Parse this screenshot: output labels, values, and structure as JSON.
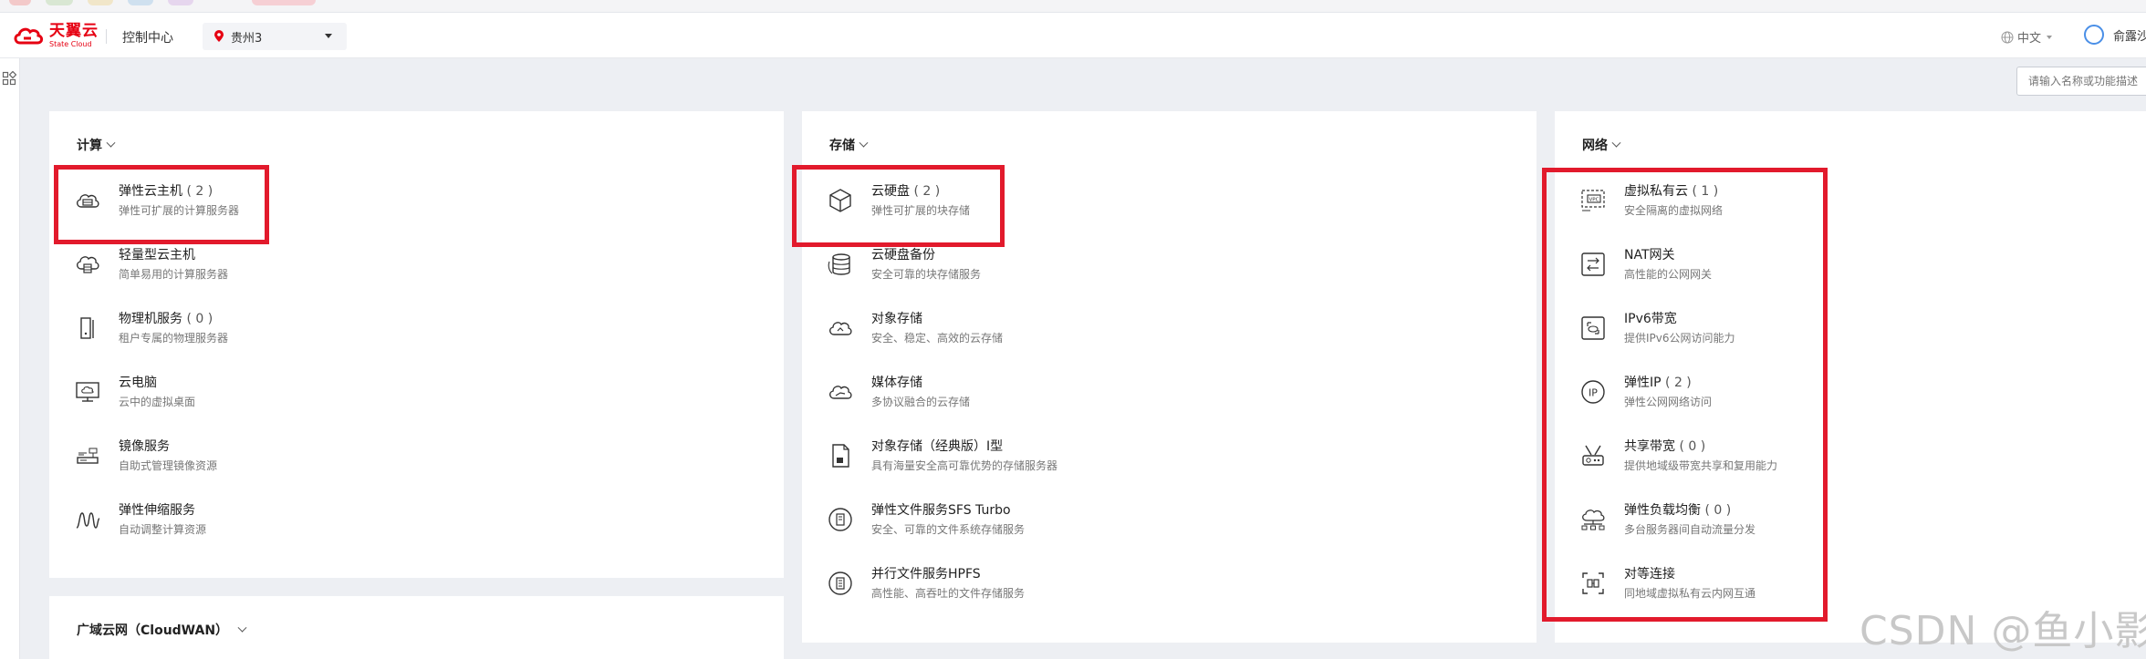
{
  "header": {
    "logo_cn": "天翼云",
    "logo_en": "State Cloud",
    "console_label": "控制中心",
    "region": "贵州3",
    "language": "中文",
    "user": "俞露沙"
  },
  "search": {
    "placeholder": "请输入名称或功能描述"
  },
  "compute": {
    "title": "计算",
    "items": [
      {
        "name": "弹性云主机",
        "count": "( 2 )",
        "desc": "弹性可扩展的计算服务器",
        "icon": "cloud-server-icon"
      },
      {
        "name": "轻量型云主机",
        "count": "",
        "desc": "简单易用的计算服务器",
        "icon": "lightweight-server-icon"
      },
      {
        "name": "物理机服务",
        "count": "( 0 )",
        "desc": "租户专属的物理服务器",
        "icon": "physical-server-icon"
      },
      {
        "name": "云电脑",
        "count": "",
        "desc": "云中的虚拟桌面",
        "icon": "cloud-desktop-icon"
      },
      {
        "name": "镜像服务",
        "count": "",
        "desc": "自助式管理镜像资源",
        "icon": "image-service-icon"
      },
      {
        "name": "弹性伸缩服务",
        "count": "",
        "desc": "自动调整计算资源",
        "icon": "auto-scaling-icon"
      }
    ]
  },
  "cloudwan": {
    "title": "广域云网（CloudWAN）"
  },
  "storage": {
    "title": "存储",
    "items": [
      {
        "name": "云硬盘",
        "count": "( 2 )",
        "desc": "弹性可扩展的块存储",
        "icon": "cloud-disk-icon"
      },
      {
        "name": "云硬盘备份",
        "count": "",
        "desc": "安全可靠的块存储服务",
        "icon": "disk-backup-icon"
      },
      {
        "name": "对象存储",
        "count": "",
        "desc": "安全、稳定、高效的云存储",
        "icon": "object-storage-icon"
      },
      {
        "name": "媒体存储",
        "count": "",
        "desc": "多协议融合的云存储",
        "icon": "media-storage-icon"
      },
      {
        "name": "对象存储（经典版）Ⅰ型",
        "count": "",
        "desc": "具有海量安全高可靠优势的存储服务器",
        "icon": "object-storage-classic-icon"
      },
      {
        "name": "弹性文件服务SFS Turbo",
        "count": "",
        "desc": "安全、可靠的文件系统存储服务",
        "icon": "sfs-turbo-icon"
      },
      {
        "name": "并行文件服务HPFS",
        "count": "",
        "desc": "高性能、高吞吐的文件存储服务",
        "icon": "hpfs-icon"
      }
    ]
  },
  "network": {
    "title": "网络",
    "items": [
      {
        "name": "虚拟私有云",
        "count": "( 1 )",
        "desc": "安全隔离的虚拟网络",
        "icon": "vpc-icon"
      },
      {
        "name": "NAT网关",
        "count": "",
        "desc": "高性能的公网网关",
        "icon": "nat-gateway-icon"
      },
      {
        "name": "IPv6带宽",
        "count": "",
        "desc": "提供IPv6公网访问能力",
        "icon": "ipv6-bandwidth-icon"
      },
      {
        "name": "弹性IP",
        "count": "( 2 )",
        "desc": "弹性公网网络访问",
        "icon": "elastic-ip-icon"
      },
      {
        "name": "共享带宽",
        "count": "( 0 )",
        "desc": "提供地域级带宽共享和复用能力",
        "icon": "shared-bandwidth-icon"
      },
      {
        "name": "弹性负载均衡",
        "count": "( 0 )",
        "desc": "多台服务器间自动流量分发",
        "icon": "load-balancer-icon"
      },
      {
        "name": "对等连接",
        "count": "",
        "desc": "同地域虚拟私有云内网互通",
        "icon": "peering-icon"
      }
    ]
  },
  "watermark": "CSDN @鱼小影",
  "colors": {
    "brand": "#e60012",
    "highlight": "#e21a2c",
    "background": "#edeff3"
  }
}
